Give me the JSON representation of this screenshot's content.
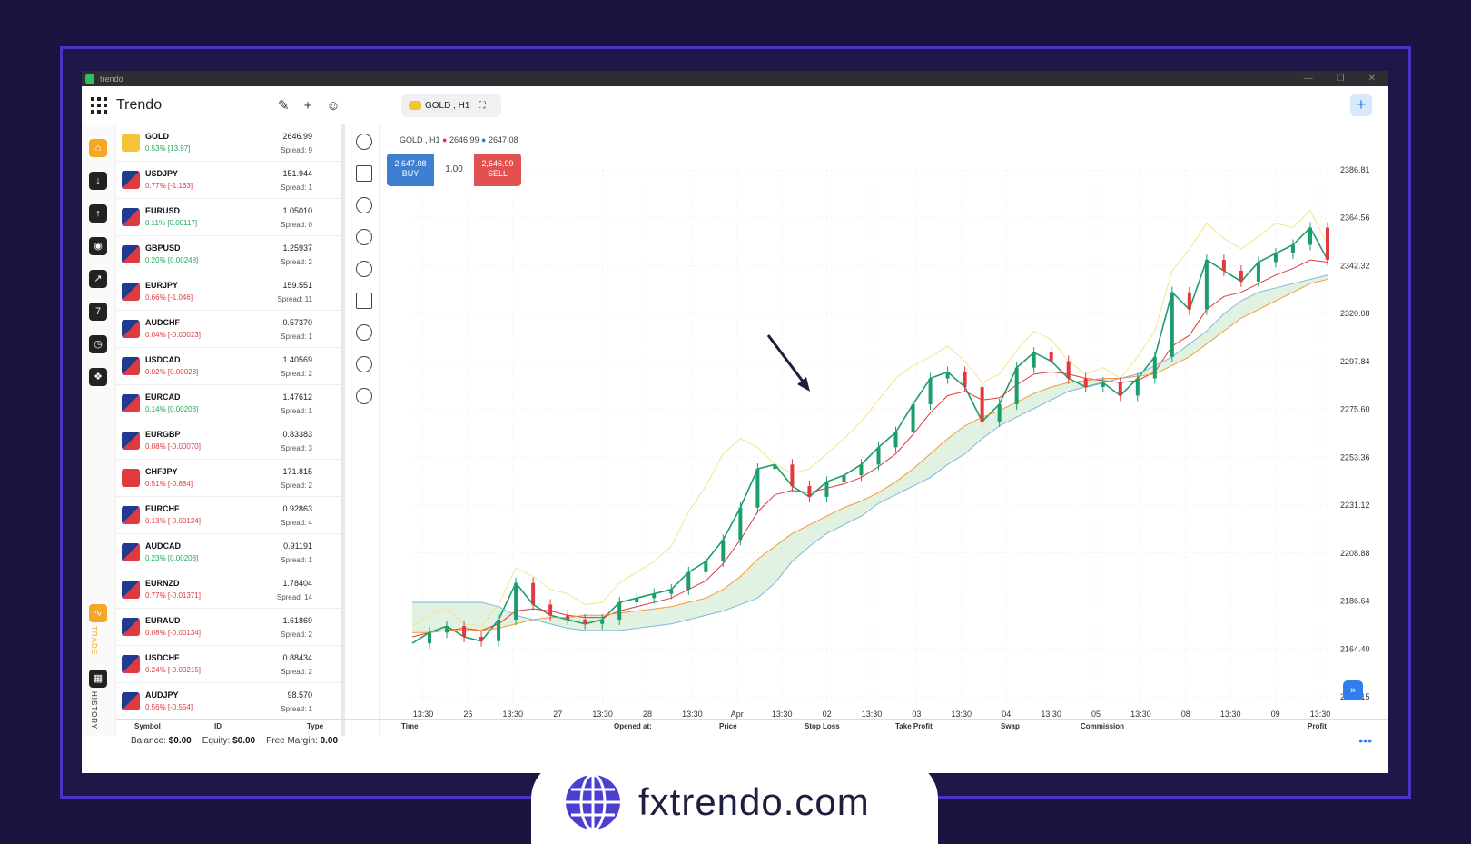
{
  "window": {
    "title": "trendo",
    "controls": [
      "—",
      "❐",
      "✕"
    ]
  },
  "app": {
    "brand": "Trendo",
    "symbol_tab": "GOLD , H1",
    "tool_icons": [
      "✎",
      "+",
      "☺"
    ],
    "add_icon": "+"
  },
  "sidebar": {
    "trade_label": "TRADE",
    "history_label": "HISTORY"
  },
  "watchlist": [
    {
      "symbol": "GOLD",
      "change": "0.53% [13.97]",
      "dir": "up",
      "price": "2646.99",
      "spread": "Spread: 9",
      "flag_colors": [
        "#f3c43a",
        "#f3c43a"
      ]
    },
    {
      "symbol": "USDJPY",
      "change": "0.77% [-1.163]",
      "dir": "dn",
      "price": "151.944",
      "spread": "Spread: 1",
      "flag_colors": [
        "#1f3b8f",
        "#e0393e"
      ]
    },
    {
      "symbol": "EURUSD",
      "change": "0.11% [0.00117]",
      "dir": "up",
      "price": "1.05010",
      "spread": "Spread: 0",
      "flag_colors": [
        "#1f3b8f",
        "#e0393e"
      ]
    },
    {
      "symbol": "GBPUSD",
      "change": "0.20% [0.00248]",
      "dir": "up",
      "price": "1.25937",
      "spread": "Spread: 2",
      "flag_colors": [
        "#1f3b8f",
        "#e0393e"
      ]
    },
    {
      "symbol": "EURJPY",
      "change": "0.66% [-1.046]",
      "dir": "dn",
      "price": "159.551",
      "spread": "Spread: 11",
      "flag_colors": [
        "#1f3b8f",
        "#e0393e"
      ]
    },
    {
      "symbol": "AUDCHF",
      "change": "0.04% [-0.00023]",
      "dir": "dn",
      "price": "0.57370",
      "spread": "Spread: 1",
      "flag_colors": [
        "#1f3b8f",
        "#e0393e"
      ]
    },
    {
      "symbol": "USDCAD",
      "change": "0.02% [0.00028]",
      "dir": "dn",
      "price": "1.40569",
      "spread": "Spread: 2",
      "flag_colors": [
        "#1f3b8f",
        "#e0393e"
      ]
    },
    {
      "symbol": "EURCAD",
      "change": "0.14% [0.00203]",
      "dir": "up",
      "price": "1.47612",
      "spread": "Spread: 1",
      "flag_colors": [
        "#1f3b8f",
        "#e0393e"
      ]
    },
    {
      "symbol": "EURGBP",
      "change": "0.08% [-0.00070]",
      "dir": "dn",
      "price": "0.83383",
      "spread": "Spread: 3",
      "flag_colors": [
        "#1f3b8f",
        "#e0393e"
      ]
    },
    {
      "symbol": "CHFJPY",
      "change": "0.51% [-0.884]",
      "dir": "dn",
      "price": "171.815",
      "spread": "Spread: 2",
      "flag_colors": [
        "#e0393e",
        "#e0393e"
      ]
    },
    {
      "symbol": "EURCHF",
      "change": "0.13% [-0.00124]",
      "dir": "dn",
      "price": "0.92863",
      "spread": "Spread: 4",
      "flag_colors": [
        "#1f3b8f",
        "#e0393e"
      ]
    },
    {
      "symbol": "AUDCAD",
      "change": "0.23% [0.00208]",
      "dir": "up",
      "price": "0.91191",
      "spread": "Spread: 1",
      "flag_colors": [
        "#1f3b8f",
        "#e0393e"
      ]
    },
    {
      "symbol": "EURNZD",
      "change": "0.77% [-0.01371]",
      "dir": "dn",
      "price": "1.78404",
      "spread": "Spread: 14",
      "flag_colors": [
        "#1f3b8f",
        "#e0393e"
      ]
    },
    {
      "symbol": "EURAUD",
      "change": "0.08% [-0.00134]",
      "dir": "dn",
      "price": "1.61869",
      "spread": "Spread: 2",
      "flag_colors": [
        "#1f3b8f",
        "#e0393e"
      ]
    },
    {
      "symbol": "USDCHF",
      "change": "0.24% [-0.00215]",
      "dir": "dn",
      "price": "0.88434",
      "spread": "Spread: 2",
      "flag_colors": [
        "#1f3b8f",
        "#e0393e"
      ]
    },
    {
      "symbol": "AUDJPY",
      "change": "0.56% [-0.554]",
      "dir": "dn",
      "price": "98.570",
      "spread": "Spread: 1",
      "flag_colors": [
        "#1f3b8f",
        "#e0393e"
      ]
    }
  ],
  "chart": {
    "legend": "GOLD , H1",
    "bid": "2646.99",
    "ask": "2647.08",
    "buy_price": "2,647.08",
    "buy_label": "BUY",
    "sell_price": "2,646.99",
    "sell_label": "SELL",
    "quantity": "1.00"
  },
  "chart_data": {
    "type": "line",
    "title": "GOLD , H1",
    "y_ticks": [
      "2386.81",
      "2364.56",
      "2342.32",
      "2320.08",
      "2297.84",
      "2275.60",
      "2253.36",
      "2231.12",
      "2208.88",
      "2186.64",
      "2164.40",
      "2142.15"
    ],
    "x_ticks": [
      "13:30",
      "26",
      "13:30",
      "27",
      "13:30",
      "28",
      "13:30",
      "Apr",
      "13:30",
      "02",
      "13:30",
      "03",
      "13:30",
      "04",
      "13:30",
      "05",
      "13:30",
      "08",
      "13:30",
      "09",
      "13:30"
    ],
    "ylim": [
      2142.15,
      2386.81
    ],
    "series": [
      {
        "values": [
          2167,
          2172,
          2175,
          2170,
          2168,
          2178,
          2195,
          2185,
          2180,
          2178,
          2176,
          2178,
          2186,
          2188,
          2190,
          2192,
          2200,
          2205,
          2215,
          2230,
          2248,
          2250,
          2240,
          2235,
          2242,
          2245,
          2250,
          2258,
          2265,
          2278,
          2290,
          2293,
          2286,
          2270,
          2278,
          2295,
          2302,
          2298,
          2290,
          2286,
          2288,
          2282,
          2290,
          2300,
          2330,
          2322,
          2345,
          2340,
          2335,
          2344,
          2348,
          2352,
          2360,
          2345
        ]
      },
      {
        "values": [
          2170,
          2172,
          2173,
          2174,
          2173,
          2176,
          2182,
          2183,
          2182,
          2180,
          2179,
          2179,
          2182,
          2184,
          2186,
          2188,
          2192,
          2196,
          2204,
          2215,
          2228,
          2236,
          2238,
          2237,
          2239,
          2241,
          2244,
          2249,
          2255,
          2264,
          2274,
          2282,
          2284,
          2280,
          2281,
          2287,
          2292,
          2293,
          2292,
          2290,
          2289,
          2288,
          2289,
          2293,
          2305,
          2310,
          2322,
          2328,
          2330,
          2334,
          2338,
          2341,
          2345,
          2344
        ]
      },
      {
        "values": [
          2172,
          2172,
          2173,
          2173,
          2173,
          2174,
          2176,
          2178,
          2179,
          2179,
          2180,
          2180,
          2181,
          2182,
          2183,
          2184,
          2186,
          2188,
          2192,
          2198,
          2206,
          2212,
          2218,
          2222,
          2226,
          2230,
          2233,
          2237,
          2242,
          2248,
          2255,
          2262,
          2268,
          2272,
          2275,
          2279,
          2283,
          2286,
          2288,
          2289,
          2290,
          2290,
          2291,
          2292,
          2296,
          2300,
          2306,
          2312,
          2318,
          2322,
          2326,
          2330,
          2334,
          2336
        ]
      },
      {
        "values": [
          2175,
          2180,
          2183,
          2176,
          2175,
          2185,
          2202,
          2198,
          2192,
          2190,
          2185,
          2186,
          2195,
          2200,
          2205,
          2212,
          2228,
          2240,
          2255,
          2262,
          2258,
          2250,
          2246,
          2248,
          2255,
          2262,
          2270,
          2280,
          2290,
          2296,
          2300,
          2305,
          2298,
          2288,
          2292,
          2303,
          2312,
          2308,
          2298,
          2292,
          2295,
          2290,
          2300,
          2312,
          2340,
          2350,
          2362,
          2355,
          2350,
          2356,
          2362,
          2360,
          2368,
          2352
        ]
      },
      {
        "values": [
          2186,
          2186,
          2186,
          2186,
          2186,
          2184,
          2180,
          2178,
          2176,
          2174,
          2173,
          2173,
          2173,
          2174,
          2175,
          2176,
          2178,
          2180,
          2182,
          2185,
          2188,
          2195,
          2205,
          2212,
          2218,
          2222,
          2226,
          2232,
          2236,
          2240,
          2244,
          2250,
          2255,
          2262,
          2268,
          2272,
          2276,
          2280,
          2284,
          2286,
          2288,
          2290,
          2292,
          2296,
          2300,
          2306,
          2312,
          2320,
          2326,
          2330,
          2332,
          2334,
          2336,
          2338
        ]
      }
    ]
  },
  "table": {
    "columns": [
      "Symbol",
      "ID",
      "Type",
      "Time",
      "Opened at:",
      "Price",
      "Stop Loss",
      "Take Profit",
      "Swap",
      "Commission",
      "Profit"
    ]
  },
  "account": {
    "balance_label": "Balance:",
    "balance": "$0.00",
    "equity_label": "Equity:",
    "equity": "$0.00",
    "free_margin_label": "Free Margin:",
    "free_margin": "0.00"
  },
  "badge": {
    "site": "fxtrendo.com"
  },
  "colors": {
    "accent": "#2f80ed",
    "up": "#22a85a",
    "down": "#e0393e",
    "frame": "#4a33c9"
  }
}
